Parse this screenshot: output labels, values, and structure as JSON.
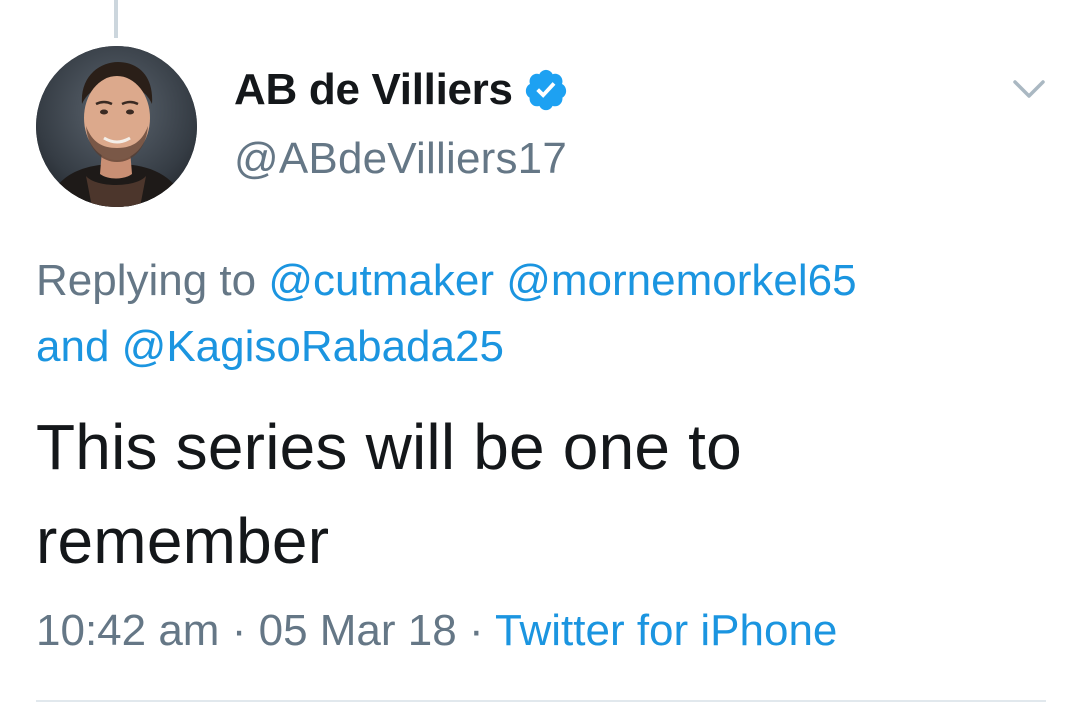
{
  "tweet": {
    "author": {
      "display_name": "AB de Villiers",
      "handle": "@ABdeVilliers17",
      "verified": true,
      "avatar_icon": "profile-photo"
    },
    "menu_icon": "chevron-down-icon",
    "reply": {
      "prefix": "Replying to",
      "mentions": [
        "@cutmaker",
        "@mornemorkel65",
        "@KagisoRabada25"
      ],
      "conjunction": "and"
    },
    "text": "This series will be one to remember",
    "time": "10:42 am",
    "date": "05 Mar 18",
    "source": "Twitter for iPhone",
    "separator": "·"
  },
  "colors": {
    "text_primary": "#14171a",
    "text_secondary": "#657786",
    "link": "#1b95e0",
    "verified_badge": "#1da1f2",
    "divider": "#e1e8ed"
  }
}
